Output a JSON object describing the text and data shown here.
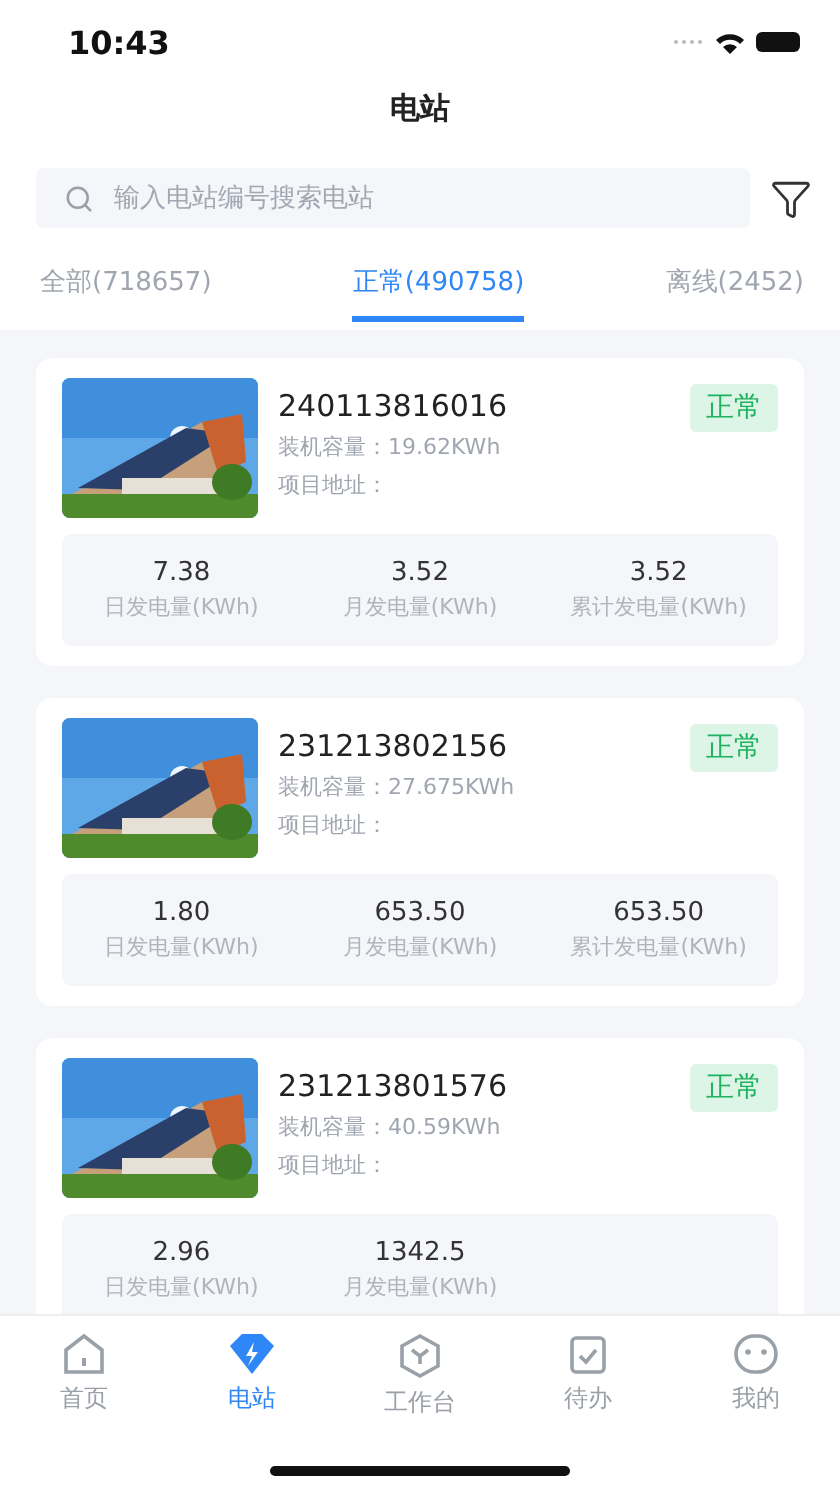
{
  "status_bar": {
    "time": "10:43"
  },
  "title": "电站",
  "search": {
    "placeholder": "输入电站编号搜索电站"
  },
  "tabs": [
    {
      "label": "全部(718657)",
      "selected": false
    },
    {
      "label": "正常(490758)",
      "selected": true
    },
    {
      "label": "离线(2452)",
      "selected": false
    }
  ],
  "stations": [
    {
      "id": "240113816016",
      "status": "正常",
      "capacity_label": "装机容量：",
      "capacity": "19.62KWh",
      "address_label": "项目地址：",
      "stats": [
        {
          "value": "7.38",
          "label": "日发电量(KWh)"
        },
        {
          "value": "3.52",
          "label": "月发电量(KWh)"
        },
        {
          "value": "3.52",
          "label": "累计发电量(KWh)"
        }
      ]
    },
    {
      "id": "231213802156",
      "status": "正常",
      "capacity_label": "装机容量：",
      "capacity": "27.675KWh",
      "address_label": "项目地址：",
      "stats": [
        {
          "value": "1.80",
          "label": "日发电量(KWh)"
        },
        {
          "value": "653.50",
          "label": "月发电量(KWh)"
        },
        {
          "value": "653.50",
          "label": "累计发电量(KWh)"
        }
      ]
    },
    {
      "id": "231213801576",
      "status": "正常",
      "capacity_label": "装机容量：",
      "capacity": "40.59KWh",
      "address_label": "项目地址：",
      "stats": [
        {
          "value": "2.96",
          "label": "日发电量(KWh)"
        },
        {
          "value": "1342.5",
          "label": "月发电量(KWh)"
        }
      ]
    }
  ],
  "nav": [
    {
      "kind": "home",
      "label": "首页",
      "selected": false
    },
    {
      "kind": "station",
      "label": "电站",
      "selected": true
    },
    {
      "kind": "workbench",
      "label": "工作台",
      "selected": false
    },
    {
      "kind": "todo",
      "label": "待办",
      "selected": false
    },
    {
      "kind": "me",
      "label": "我的",
      "selected": false
    }
  ]
}
